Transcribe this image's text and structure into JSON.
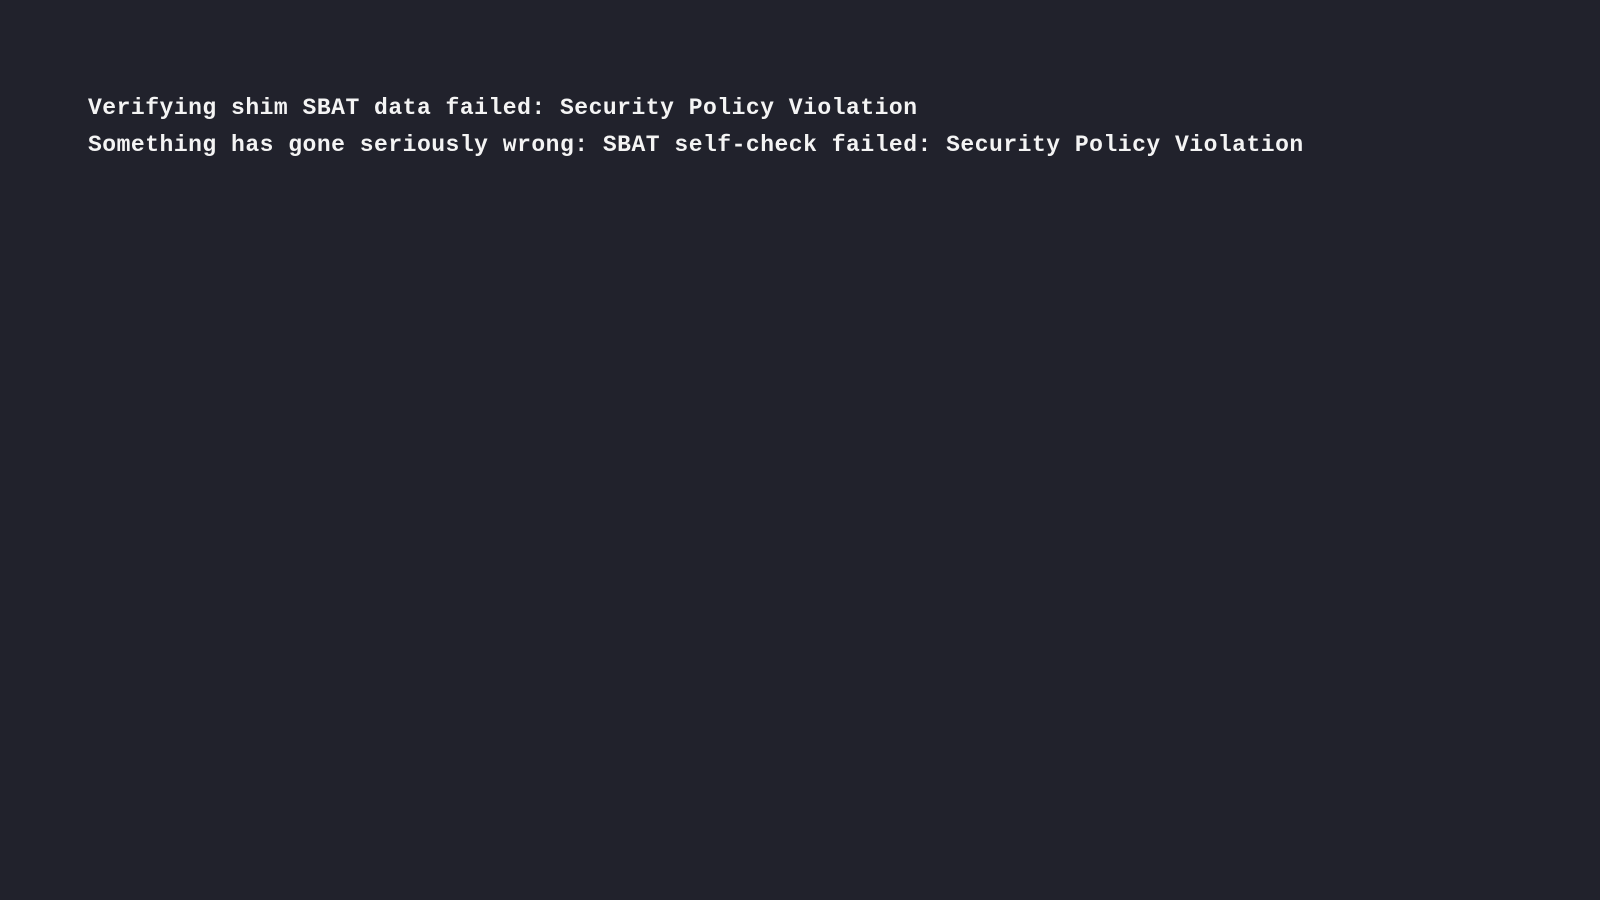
{
  "console": {
    "lines": [
      "Verifying shim SBAT data failed: Security Policy Violation",
      "Something has gone seriously wrong: SBAT self-check failed: Security Policy Violation"
    ]
  }
}
